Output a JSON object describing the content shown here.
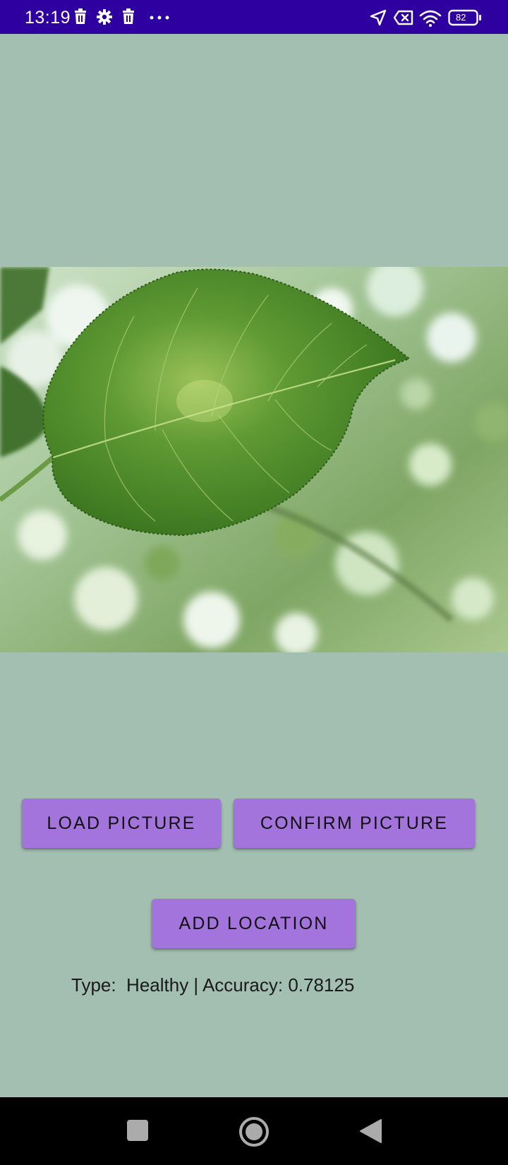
{
  "status_bar": {
    "time": "13:19",
    "battery_level": "82",
    "background_color": "#2e00a0",
    "left_icons": [
      "trash-icon",
      "gear-icon",
      "trash-icon",
      "more-dots-icon"
    ],
    "right_icons": [
      "location-arrow-icon",
      "no-sim-icon",
      "wifi-icon",
      "battery-icon"
    ]
  },
  "main": {
    "background_color": "#a3bfb1",
    "image": {
      "subject": "leaf-photo"
    },
    "buttons": {
      "load_picture": "LOAD PICTURE",
      "confirm_picture": "CONFIRM PICTURE",
      "add_location": "ADD LOCATION",
      "color": "#a274dc"
    },
    "result": "Type:  Healthy | Accuracy: 0.78125"
  },
  "nav_bar": {
    "icons": [
      "square-recents-icon",
      "circle-home-icon",
      "triangle-back-icon"
    ]
  }
}
